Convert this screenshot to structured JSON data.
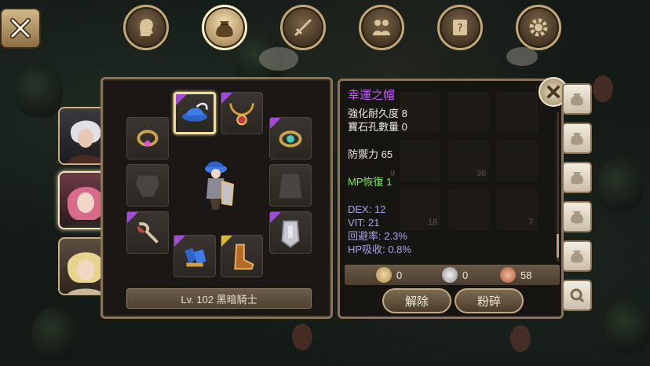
{
  "nav": {
    "tabs": [
      {
        "name": "character",
        "icon": "head-icon"
      },
      {
        "name": "bag",
        "icon": "bag-icon"
      },
      {
        "name": "skills",
        "icon": "sword-icon"
      },
      {
        "name": "party",
        "icon": "people-icon"
      },
      {
        "name": "quest",
        "icon": "scroll-icon"
      },
      {
        "name": "settings",
        "icon": "gear-icon"
      }
    ],
    "active": "bag"
  },
  "equipment": {
    "level_label": "Lv. 102 黑暗騎士"
  },
  "item_detail": {
    "name": "幸運之帽",
    "enhance_durability": "強化耐久度 8",
    "gem_slots": "寶石孔數量 0",
    "defense": "防禦力 65",
    "mp_restore": "MP恢復 1",
    "dex": "DEX: 12",
    "vit": "VIT: 21",
    "evasion": "回避率: 2.3%",
    "hp_absorb": "HP吸收: 0.8%"
  },
  "background_grid_counts": [
    "9",
    "36",
    "18",
    "7"
  ],
  "currency": {
    "gold": "0",
    "silver": "0",
    "copper": "58"
  },
  "actions": {
    "unequip_label": "解除",
    "shatter_label": "粉碎"
  },
  "colors": {
    "item_name": "#c15cf0",
    "mp_stat": "#7cf25a",
    "bonus_stat": "#a9a3ef",
    "frame": "#8a7356",
    "rarity_purple": "#a14ad8",
    "rarity_gold": "#d8b83c"
  }
}
